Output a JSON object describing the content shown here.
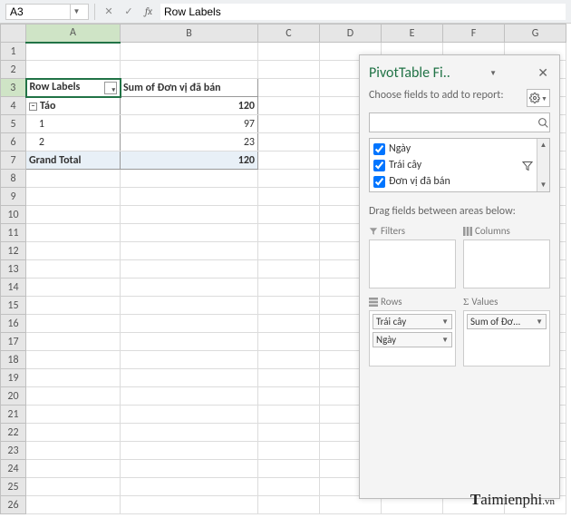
{
  "namebox": {
    "value": "A3"
  },
  "formula": {
    "value": "Row Labels"
  },
  "columns": [
    "A",
    "B",
    "C",
    "D",
    "E",
    "F",
    "G"
  ],
  "rowcount": 26,
  "pivot": {
    "header": {
      "rowlabels": "Row Labels",
      "sum": "Sum of Đơn vị đã bán"
    },
    "group": {
      "name": "Táo",
      "total": "120"
    },
    "rows": [
      {
        "label": "1",
        "val": "97"
      },
      {
        "label": "2",
        "val": "23"
      }
    ],
    "grand": {
      "label": "Grand Total",
      "val": "120"
    }
  },
  "panel": {
    "title": "PivotTable Fi..",
    "subtitle": "Choose fields to add to report:",
    "fields": [
      {
        "name": "Ngày",
        "checked": true
      },
      {
        "name": "Trái cây",
        "checked": true,
        "filtered": true
      },
      {
        "name": "Đơn vị đã bán",
        "checked": true
      }
    ],
    "dragtext": "Drag fields between areas below:",
    "areas": {
      "filters": "Filters",
      "columns": "Columns",
      "rows": "Rows",
      "values": "Values"
    },
    "rowsChips": [
      "Trái cây",
      "Ngày"
    ],
    "valuesChips": [
      "Sum of Đơ..."
    ]
  },
  "watermark": {
    "a": "T",
    "b": "aimienphi",
    "c": ".vn"
  }
}
